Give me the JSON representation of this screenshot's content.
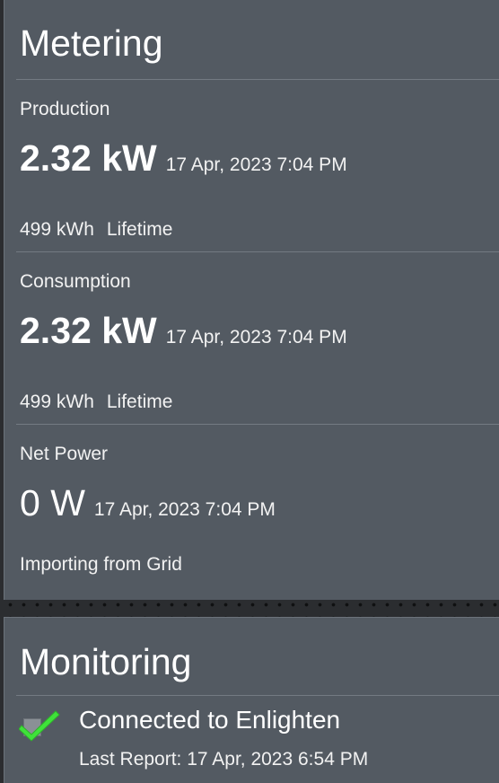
{
  "metering": {
    "title": "Metering",
    "production": {
      "label": "Production",
      "value": "2.32 kW",
      "timestamp": "17 Apr, 2023 7:04 PM",
      "lifetime_value": "499 kWh",
      "lifetime_label": "Lifetime"
    },
    "consumption": {
      "label": "Consumption",
      "value": "2.32 kW",
      "timestamp": "17 Apr, 2023 7:04 PM",
      "lifetime_value": "499 kWh",
      "lifetime_label": "Lifetime"
    },
    "net_power": {
      "label": "Net Power",
      "value": "0 W",
      "timestamp": "17 Apr, 2023 7:04 PM",
      "status": "Importing from Grid"
    }
  },
  "monitoring": {
    "title": "Monitoring",
    "status_icon": "check-icon",
    "status_text": "Connected to Enlighten",
    "last_report": "Last Report: 17 Apr, 2023 6:54 PM"
  },
  "colors": {
    "panel_bg": "#535a62",
    "page_bg": "#2b2d30",
    "check_green": "#3fe23a"
  }
}
